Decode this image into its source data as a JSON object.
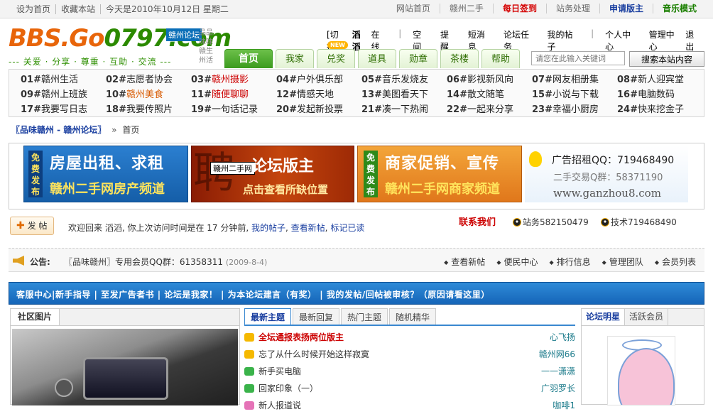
{
  "topbar": {
    "left": [
      "设为首页",
      "收藏本站",
      "今天是2010年10月12日 星期二"
    ],
    "right": {
      "home": "网站首页",
      "secondhand": "赣州二手",
      "checkin": "每日签到",
      "admin": "站务处理",
      "apply": "申请版主",
      "music": "音乐模式"
    }
  },
  "logo": {
    "main1": "BBS.Go",
    "main2": "0797",
    "main3": ".com",
    "tag": "赣州论坛",
    "side": "品品味味赣生州活",
    "slogan": "--- 关爱 · 分享 · 尊重 · 互助 · 交流 ---"
  },
  "usernav": {
    "switch": "[切换]",
    "username": "滔滔",
    "status": "在线",
    "space": "空间",
    "remind": "提醒",
    "sms": "短消息",
    "tasks": "论坛任务",
    "myposts": "我的帖子",
    "center": "个人中心",
    "manage": "管理中心",
    "logout": "退出"
  },
  "tabs": [
    "首页",
    "我家",
    "兑奖",
    "道具",
    "勋章",
    "茶楼",
    "帮助"
  ],
  "new_badge": "NEW",
  "search": {
    "placeholder": "请您在此输入关键词",
    "button": "搜索本站内容"
  },
  "categories": [
    [
      {
        "n": "01#",
        "t": "赣州生活"
      },
      {
        "n": "02#",
        "t": "志愿者协会"
      },
      {
        "n": "03#",
        "t": "赣州摄影",
        "c": "red"
      },
      {
        "n": "04#",
        "t": "户外俱乐部"
      },
      {
        "n": "05#",
        "t": "音乐发烧友"
      },
      {
        "n": "06#",
        "t": "影视新风向"
      },
      {
        "n": "07#",
        "t": "网友相册集"
      },
      {
        "n": "08#",
        "t": "新人迎宾堂"
      }
    ],
    [
      {
        "n": "09#",
        "t": "赣州上班族"
      },
      {
        "n": "10#",
        "t": "赣州美食",
        "c": "orange"
      },
      {
        "n": "11#",
        "t": "随便聊聊",
        "c": "red"
      },
      {
        "n": "12#",
        "t": "情感天地"
      },
      {
        "n": "13#",
        "t": "美图看天下"
      },
      {
        "n": "14#",
        "t": "散文随笔"
      },
      {
        "n": "15#",
        "t": "小说与下载"
      },
      {
        "n": "16#",
        "t": "电脑数码"
      }
    ],
    [
      {
        "n": "17#",
        "t": "我要写日志"
      },
      {
        "n": "18#",
        "t": "我要传照片"
      },
      {
        "n": "19#",
        "t": "一句话记录"
      },
      {
        "n": "20#",
        "t": "发起新投票"
      },
      {
        "n": "21#",
        "t": "凑一下热闹"
      },
      {
        "n": "22#",
        "t": "一起来分享"
      },
      {
        "n": "23#",
        "t": "幸福小厨房"
      },
      {
        "n": "24#",
        "t": "快来挖金子"
      }
    ]
  ],
  "breadcrumb": {
    "home": "〖品味赣州 - 赣州论坛〗",
    "sep": "»",
    "current": "首页"
  },
  "banners": {
    "b1": {
      "tag": "免费发布",
      "line1": "房屋出租、求租",
      "line2": "赣州二手网房产频道"
    },
    "b2": {
      "big": "聘",
      "tip": "赣州二手网",
      "line1": "论坛版主",
      "line2": "点击查看所缺位置"
    },
    "b3": {
      "tag": "免费发布",
      "line1": "商家促销、宣传",
      "line2": "赣州二手网商家频道"
    },
    "b4": {
      "line1": "广告招租QQ：719468490",
      "line2": "二手交易Q群：58371190",
      "line3": "www.ganzhou8.com"
    }
  },
  "post_button": "发 帖",
  "welcome": {
    "pre": "欢迎回来 滔滔, 你上次访问时间是在 17 分钟前,",
    "myposts": "我的帖子",
    "newposts": "查看新帖",
    "markread": "标记已读"
  },
  "contact": {
    "title": "联系我们",
    "q1": "站务582150479",
    "q2": "技术719468490"
  },
  "notice": {
    "label": "公告:",
    "text": "〖品味赣州〗专用会员QQ群：61358311",
    "date": "(2009-8-4)",
    "links": [
      "查看新帖",
      "便民中心",
      "排行信息",
      "管理团队",
      "会员列表"
    ]
  },
  "bluebar": "客服中心|新手指导 | 至发广告者书 | 论坛是我家！ | 为本论坛建言（有奖） | 我的发帖/回帖被审核？（原因请看这里）",
  "left_panel": {
    "title": "社区图片"
  },
  "mid_panel": {
    "tabs": [
      "最新主题",
      "最新回复",
      "热门主题",
      "随机精华"
    ],
    "rows": [
      {
        "title": "全坛通报表扬两位版主",
        "author": "心飞扬",
        "icon": "y",
        "hot": true
      },
      {
        "title": "忘了从什么时候开始这样寂寞",
        "author": "赣州网66",
        "icon": "y"
      },
      {
        "title": "新手买电脑",
        "author": "一一潇潇",
        "icon": "g"
      },
      {
        "title": "回家印象（一）",
        "author": "广羽罗长",
        "icon": "g"
      },
      {
        "title": "新人报道说",
        "author": "咖啡1",
        "icon": "p"
      }
    ]
  },
  "right_panel": {
    "tabs": [
      "论坛明星",
      "活跃会员"
    ]
  },
  "colors": {
    "accent_green": "#3b9b1e",
    "link_blue": "#1a3fa0",
    "hot_red": "#cc0000",
    "bar_blue": "#1565b8"
  }
}
